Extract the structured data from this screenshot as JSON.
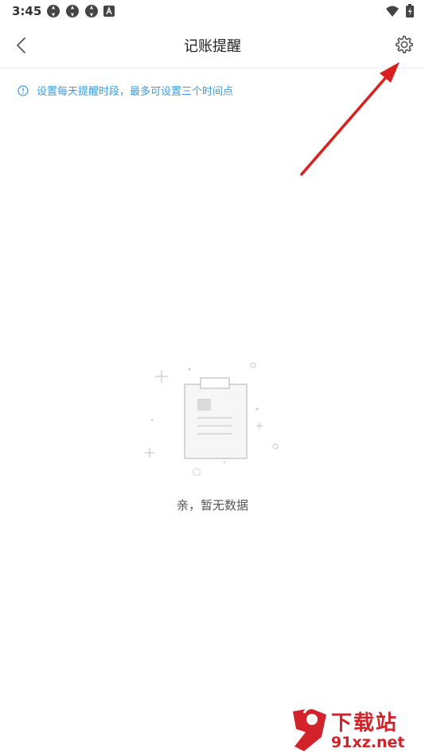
{
  "status_bar": {
    "time": "3:45"
  },
  "header": {
    "title": "记账提醒"
  },
  "notice": {
    "text": "设置每天提醒时段，最多可设置三个时间点"
  },
  "empty_state": {
    "text": "亲，暂无数据"
  },
  "watermark": {
    "brand": "下载站",
    "site": "91xz.net"
  },
  "colors": {
    "accent": "#3a9be6",
    "arrow": "#d9201f",
    "watermark": "#d3232a"
  }
}
